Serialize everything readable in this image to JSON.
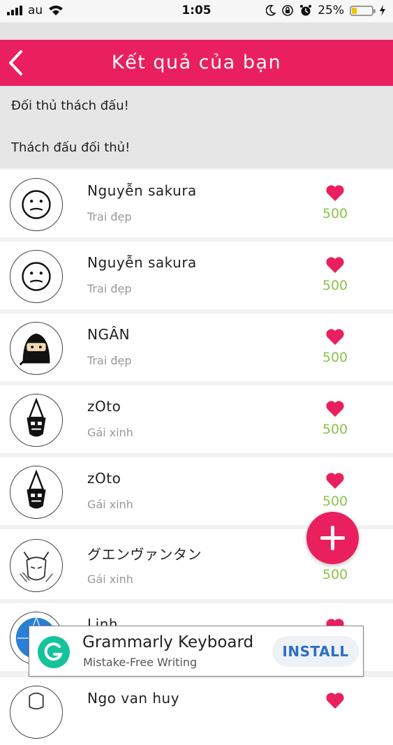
{
  "status": {
    "carrier": "au",
    "time": "1:05",
    "battery": "25%",
    "battery_level": 0.25
  },
  "header": {
    "title": "Kết quả của bạn"
  },
  "challenge": {
    "item1": "Đối thủ thách đấu!",
    "item2": "Thách đấu đối thủ!"
  },
  "rows": [
    {
      "name": "Nguyễn sakura",
      "sub": "Trai đẹp",
      "score": "500",
      "avatar": "smiley-avatar"
    },
    {
      "name": "Nguyễn sakura",
      "sub": "Trai đẹp",
      "score": "500",
      "avatar": "smiley-avatar"
    },
    {
      "name": "NGÂN",
      "sub": "Trai đẹp",
      "score": "500",
      "avatar": "ninja-avatar"
    },
    {
      "name": "zOto",
      "sub": "Gái xinh",
      "score": "500",
      "avatar": "troll-avatar"
    },
    {
      "name": "zOto",
      "sub": "Gái xinh",
      "score": "500",
      "avatar": "troll-avatar"
    },
    {
      "name": "グエンヴァンタン",
      "sub": "Gái xinh",
      "score": "500",
      "avatar": "wolverine-avatar"
    },
    {
      "name": "Linh",
      "sub": "",
      "score": "",
      "avatar": "globe-avatar"
    },
    {
      "name": "Ngo van huy",
      "sub": "",
      "score": "",
      "avatar": "sketch-avatar"
    }
  ],
  "ad": {
    "title": "Grammarly Keyboard",
    "subtitle": "Mistake-Free Writing",
    "install": "INSTALL"
  },
  "colors": {
    "accent": "#ea1f5e",
    "score": "#8bc34a",
    "grammarly": "#15c39a"
  }
}
